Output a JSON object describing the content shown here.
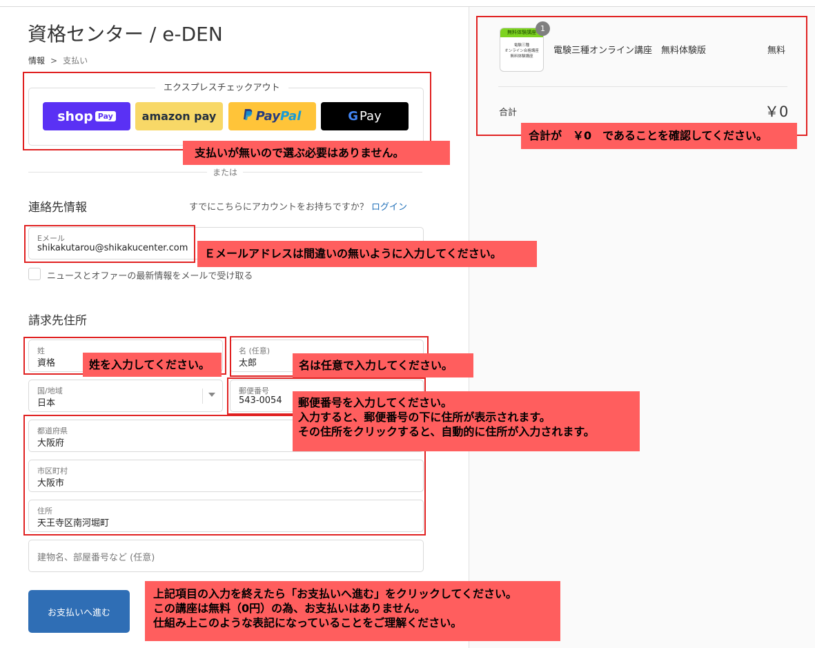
{
  "header": {
    "store_name": "資格センター / e-DEN",
    "breadcrumb": {
      "step1": "情報",
      "separator": ">",
      "step2": "支払い"
    }
  },
  "express": {
    "title": "エクスプレスチェックアウト",
    "buttons": {
      "shop": "shop",
      "shop_tag": "Pay",
      "amazon": "amazon pay",
      "paypal_a": "Pay",
      "paypal_b": "Pal",
      "gpay_g": "G",
      "gpay_text": "Pay"
    },
    "or": "または"
  },
  "contact": {
    "title": "連絡先情報",
    "have_account": "すでにこちらにアカウントをお持ちですか？",
    "login": "ログイン",
    "email": {
      "label": "Eメール",
      "value": "shikakutarou@shikakucenter.com"
    },
    "newsletter": "ニュースとオファーの最新情報をメールで受け取る"
  },
  "billing": {
    "title": "請求先住所",
    "last_name": {
      "label": "姓",
      "value": "資格"
    },
    "first_name": {
      "label": "名 (任意)",
      "value": "太郎"
    },
    "country": {
      "label": "国/地域",
      "value": "日本"
    },
    "postal": {
      "label": "郵便番号",
      "value": "543-0054"
    },
    "prefecture": {
      "label": "都道府県",
      "value": "大阪府"
    },
    "city": {
      "label": "市区町村",
      "value": "大阪市"
    },
    "address": {
      "label": "住所",
      "value": "天王寺区南河堀町"
    },
    "building_placeholder": "建物名、部屋番号など (任意)"
  },
  "actions": {
    "continue": "お支払いへ進む"
  },
  "summary": {
    "thumb_top": "無料体験講座",
    "thumb_lines": [
      "電験三種",
      "オンライン合格講座",
      "無料体験講座"
    ],
    "quantity": "1",
    "product_name": "電験三種オンライン講座　無料体験版",
    "product_price": "無料",
    "total_label": "合計",
    "total_value": "￥0"
  },
  "annotations": {
    "express": "支払いが無いので選ぶ必要はありません。",
    "email": "Ｅメールアドレスは間違いの無いように入力してください。",
    "last_name": "姓を入力してください。",
    "first_name": "名は任意で入力してください。",
    "postal_lines": [
      "郵便番号を入力してください。",
      "入力すると、郵便番号の下に住所が表示されます。",
      "その住所をクリックすると、自動的に住所が入力されます。"
    ],
    "continue_lines": [
      "上記項目の入力を終えたら「お支払いへ進む」をクリックしてください。",
      "この講座は無料（0円）の為、お支払いはありません。",
      "仕組み上このような表記になっていることをご理解ください。"
    ],
    "total": "合計が　￥0　であることを確認してください。"
  },
  "colors": {
    "shop_pay": "#5a31f4",
    "amazon_pay": "#f8d867",
    "paypal": "#ffc439",
    "primary_button": "#2f6eb5",
    "annotation_fill": "#ff5e5e",
    "annotation_border": "#e02020"
  }
}
